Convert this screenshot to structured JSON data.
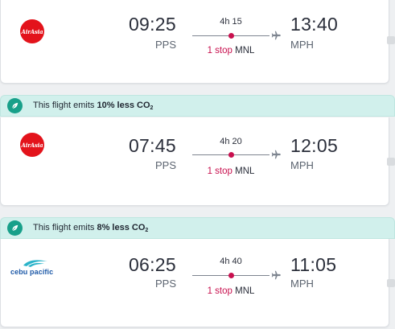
{
  "flights": [
    {
      "airline": {
        "name": "AirAsia",
        "logo_text": "AirAsia"
      },
      "departure_time": "09:25",
      "departure_airport": "PPS",
      "arrival_time": "13:40",
      "arrival_airport": "MPH",
      "duration": "4h 15",
      "stop_count": "1 stop",
      "stop_airport": "MNL"
    },
    {
      "eco_banner": {
        "prefix": "This flight emits ",
        "emphasis": "10% less CO",
        "subscript": "2"
      },
      "airline": {
        "name": "AirAsia",
        "logo_text": "AirAsia"
      },
      "departure_time": "07:45",
      "departure_airport": "PPS",
      "arrival_time": "12:05",
      "arrival_airport": "MPH",
      "duration": "4h 20",
      "stop_count": "1 stop",
      "stop_airport": "MNL"
    },
    {
      "eco_banner": {
        "prefix": "This flight emits ",
        "emphasis": "8% less CO",
        "subscript": "2"
      },
      "airline": {
        "name": "Cebu Pacific",
        "logo_text": "cebu pacific"
      },
      "departure_time": "06:25",
      "departure_airport": "PPS",
      "arrival_time": "11:05",
      "arrival_airport": "MPH",
      "duration": "4h 40",
      "stop_count": "1 stop",
      "stop_airport": "MNL"
    }
  ],
  "icons": {
    "eco": "leaf-icon",
    "arrival": "airplane-icon",
    "stop": "stop-dot"
  },
  "colors": {
    "stop_accent": "#c8104e",
    "eco_banner_bg": "#d1f0ec",
    "eco_badge": "#18a08a",
    "airasia_red": "#e3131b",
    "cebu_blue": "#1e5aa8",
    "cebu_teal": "#2ab3c9"
  }
}
